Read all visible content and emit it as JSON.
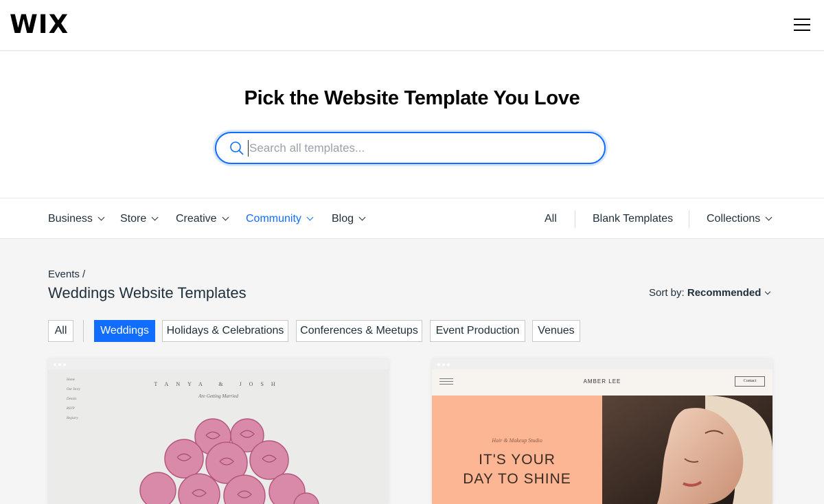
{
  "header": {
    "logo": "WIX"
  },
  "hero": {
    "title": "Pick the Website Template You Love",
    "search_placeholder": "Search all templates..."
  },
  "category_nav": {
    "left": [
      {
        "label": "Business",
        "dropdown": true
      },
      {
        "label": "Store",
        "dropdown": true
      },
      {
        "label": "Creative",
        "dropdown": true
      },
      {
        "label": "Community",
        "dropdown": true,
        "active": true
      },
      {
        "label": "Blog",
        "dropdown": true
      }
    ],
    "right": [
      {
        "label": "All"
      },
      {
        "label": "Blank Templates"
      },
      {
        "label": "Collections",
        "dropdown": true
      }
    ]
  },
  "content": {
    "breadcrumb": "Events /",
    "title": "Weddings Website Templates",
    "sort": {
      "label": "Sort by:",
      "value": "Recommended"
    },
    "filters": [
      {
        "label": "All"
      },
      {
        "label": "Weddings",
        "active": true
      },
      {
        "label": "Holidays & Celebrations"
      },
      {
        "label": "Conferences & Meetups"
      },
      {
        "label": "Event Production"
      },
      {
        "label": "Venues"
      }
    ]
  },
  "templates": [
    {
      "names": "TANYA & JOSH",
      "subtitle": "Are Getting Married",
      "menu": [
        "Home",
        "Our Story",
        "Details",
        "RSVP",
        "Registry"
      ]
    },
    {
      "brand": "AMBER LEE",
      "contact": "Contact",
      "kicker": "Hair & Makeup Studio",
      "headline_1": "IT'S YOUR",
      "headline_2": "DAY TO SHINE"
    }
  ],
  "colors": {
    "accent": "#116dff",
    "text": "#20303c",
    "peach": "#fcb694"
  }
}
